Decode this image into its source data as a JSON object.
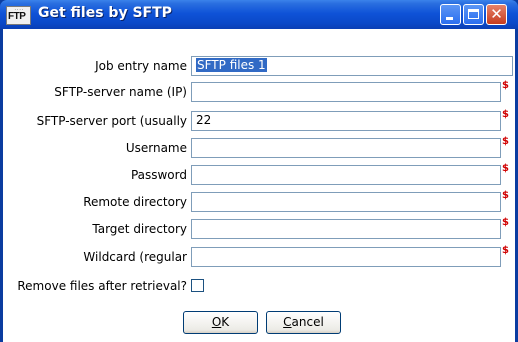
{
  "window": {
    "title": "Get files by SFTP",
    "icon_small_text": "....",
    "icon_text": "FTP"
  },
  "form": {
    "job_entry_name": {
      "label": "Job entry name",
      "value": "SFTP files 1"
    },
    "server_name": {
      "label": "SFTP-server name (IP)",
      "value": ""
    },
    "server_port": {
      "label": "SFTP-server port (usually",
      "value": "22"
    },
    "username": {
      "label": "Username",
      "value": ""
    },
    "password": {
      "label": "Password",
      "value": ""
    },
    "remote_directory": {
      "label": "Remote directory",
      "value": ""
    },
    "target_directory": {
      "label": "Target directory",
      "value": ""
    },
    "wildcard": {
      "label": "Wildcard (regular",
      "value": ""
    },
    "remove_files": {
      "label": "Remove files after retrieval?",
      "checked": false
    },
    "variable_marker": "$"
  },
  "buttons": {
    "ok_mnemonic": "O",
    "ok_rest": "K",
    "cancel_mnemonic": "C",
    "cancel_rest": "ancel"
  },
  "colors": {
    "titlebar": "#0a48c8",
    "field_border": "#7f9db9",
    "variable_marker": "#d00000",
    "selection": "#316ac5"
  }
}
